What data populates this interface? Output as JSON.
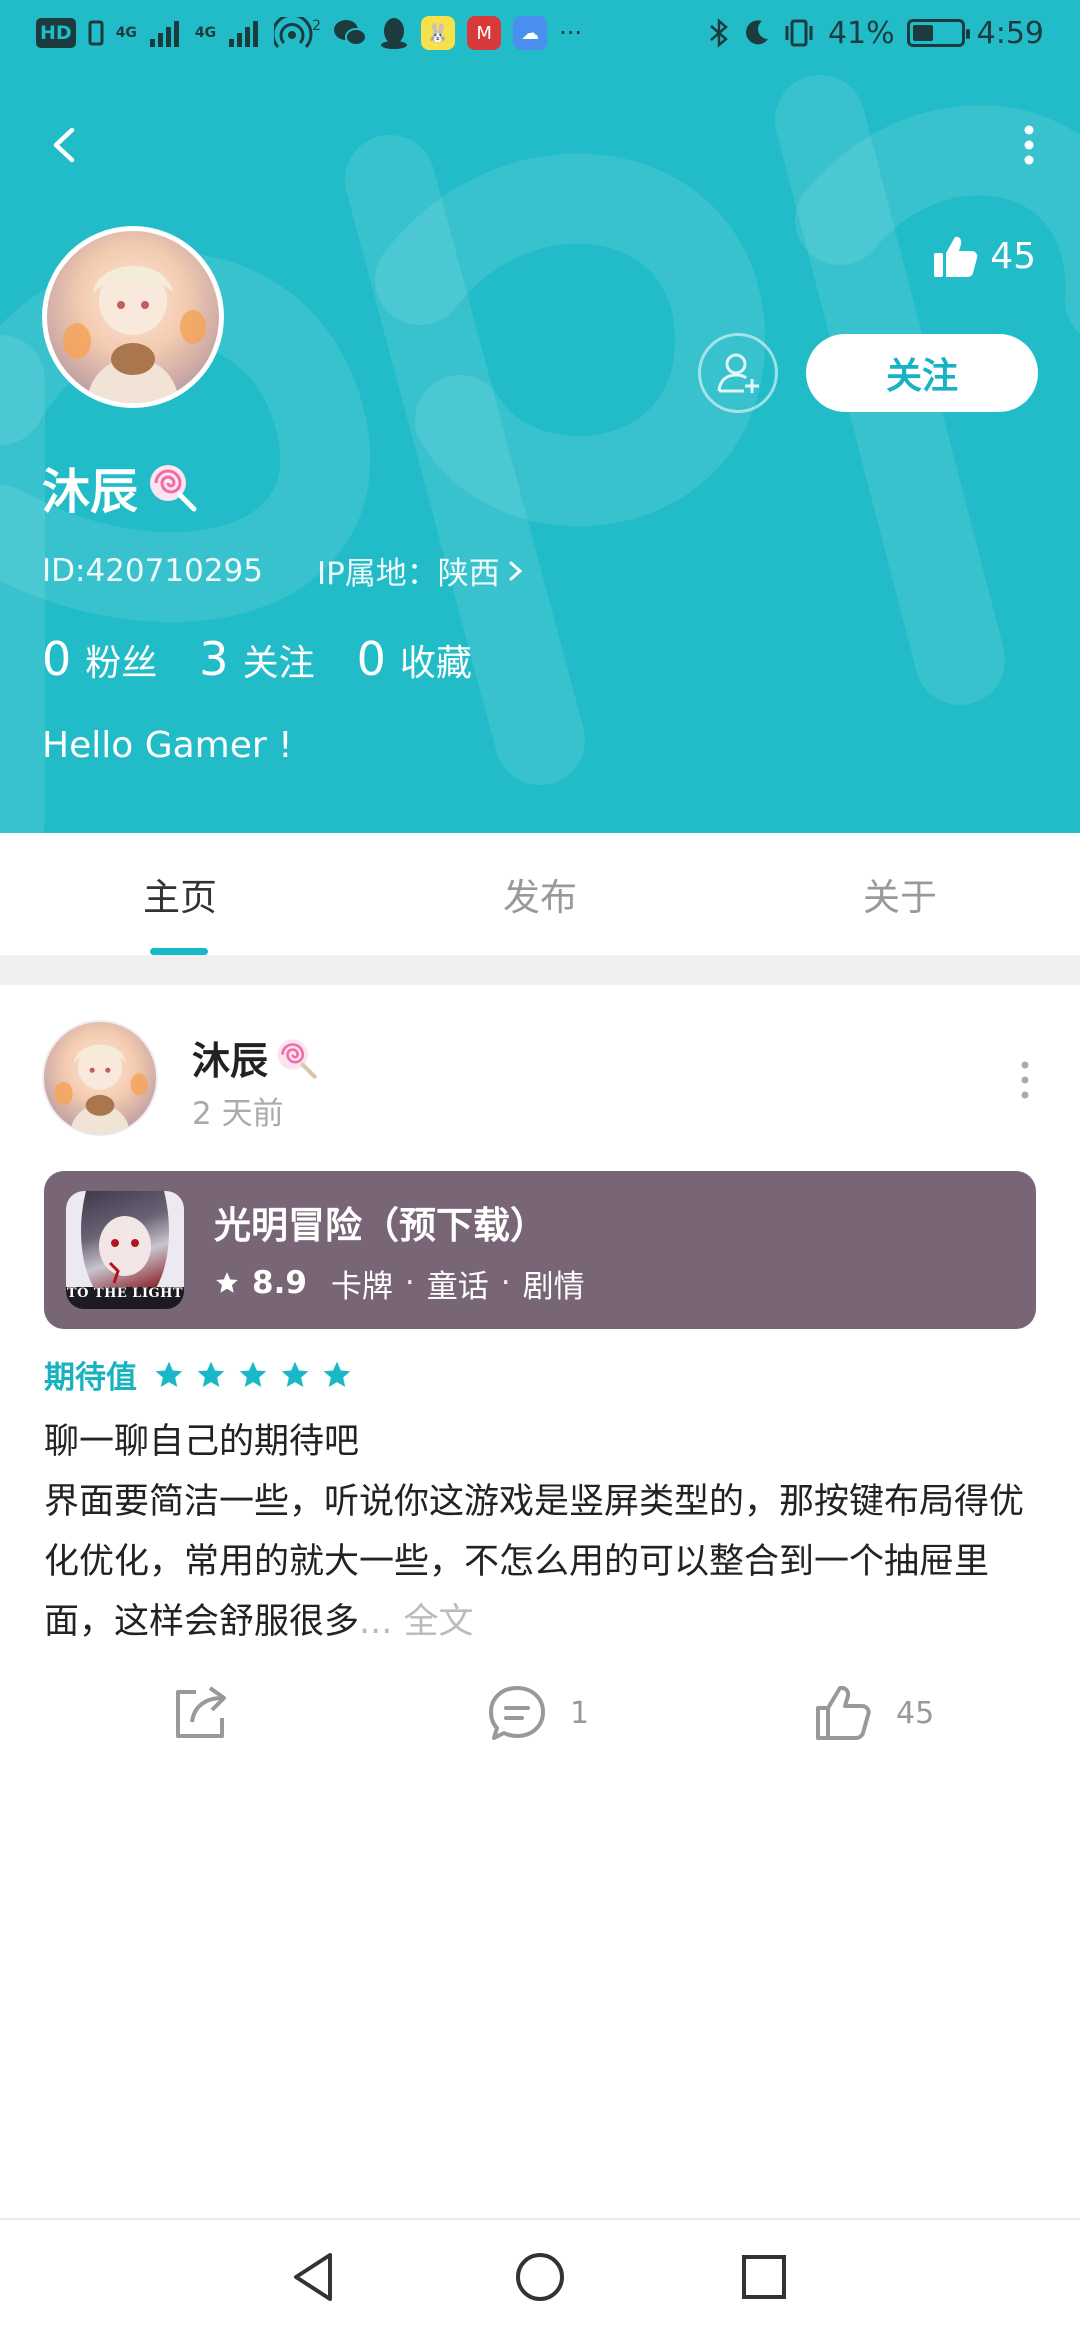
{
  "status_bar": {
    "left_chips": [
      "HD",
      "4G",
      "4G"
    ],
    "wifi_sup": "2",
    "overflow": "···",
    "battery_percent": "41%",
    "time": "4:59"
  },
  "header": {
    "likes_count": "45",
    "follow_label": "关注",
    "username": "沐辰",
    "id_text": "ID:420710295",
    "ip_text": "IP属地：陕西",
    "stats": [
      {
        "num": "0",
        "label": "粉丝"
      },
      {
        "num": "3",
        "label": "关注"
      },
      {
        "num": "0",
        "label": "收藏"
      }
    ],
    "bio": "Hello Gamer !"
  },
  "tabs": [
    {
      "label": "主页",
      "active": true
    },
    {
      "label": "发布",
      "active": false
    },
    {
      "label": "关于",
      "active": false
    }
  ],
  "post": {
    "author": "沐辰",
    "time": "2 天前",
    "game": {
      "title": "光明冒险（预下载）",
      "icon_caption": "TO THE LIGHT",
      "score": "8.9",
      "tags": [
        "卡牌",
        "童话",
        "剧情"
      ]
    },
    "rating_label": "期待值",
    "rating_stars": 5,
    "text_line1": "聊一聊自己的期待吧",
    "text_body": "界面要简洁一些，听说你这游戏是竖屏类型的，那按键布局得优化优化，常用的就大一些，不怎么用的可以整合到一个抽屉里面，这样会舒服很多",
    "more_link": "... 全文",
    "comment_count": "1",
    "like_count": "45"
  },
  "colors": {
    "header_bg": "#22bcc9",
    "accent": "#19b8c6",
    "game_card_bg": "#786677"
  }
}
